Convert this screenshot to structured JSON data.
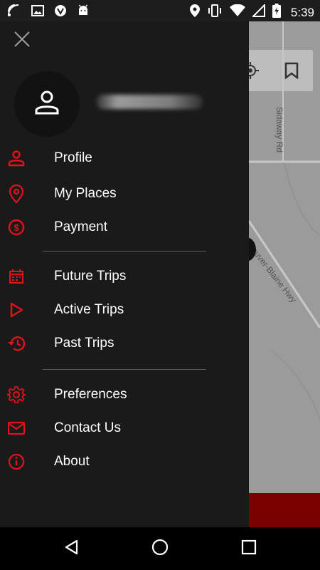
{
  "status_bar": {
    "time": "5:39",
    "left_icons": [
      "wifi-signal-icon",
      "image-icon",
      "shield-icon",
      "android-icon"
    ],
    "right_icons": [
      "location-icon",
      "vibrate-icon",
      "wifi-icon",
      "signal-icon",
      "battery-charging-icon"
    ]
  },
  "map": {
    "road_labels": [
      "Sidaway Rd",
      "couver-Blaine Hwy"
    ]
  },
  "drawer": {
    "menu_groups": [
      [
        {
          "label": "Profile",
          "icon": "person-icon"
        },
        {
          "label": "My Places",
          "icon": "location-pin-icon"
        },
        {
          "label": "Payment",
          "icon": "dollar-icon"
        }
      ],
      [
        {
          "label": "Future Trips",
          "icon": "calendar-icon"
        },
        {
          "label": "Active Trips",
          "icon": "play-icon"
        },
        {
          "label": "Past Trips",
          "icon": "history-icon"
        }
      ],
      [
        {
          "label": "Preferences",
          "icon": "gear-icon"
        },
        {
          "label": "Contact Us",
          "icon": "mail-icon"
        },
        {
          "label": "About",
          "icon": "info-icon"
        }
      ]
    ]
  },
  "colors": {
    "accent": "#e0121a",
    "drawer_bg": "#1a1a1a",
    "text": "#ffffff"
  },
  "nav_bar": {
    "buttons": [
      "back-icon",
      "home-icon",
      "recents-icon"
    ]
  }
}
